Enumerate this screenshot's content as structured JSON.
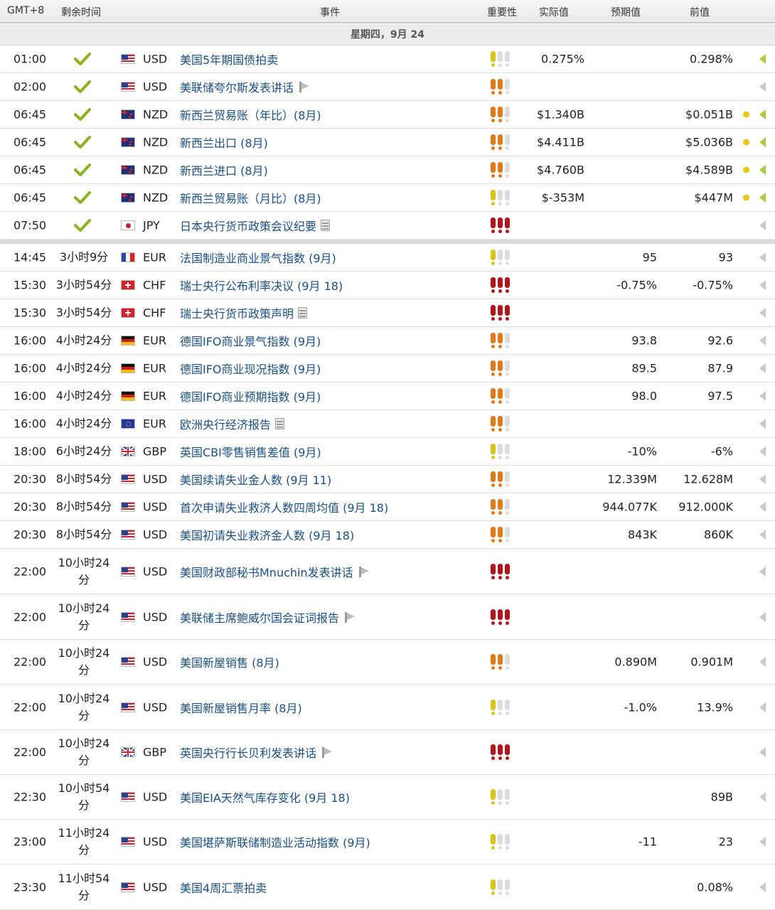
{
  "header": {
    "timezone": "GMT+8",
    "remaining": "剩余时间",
    "event": "事件",
    "importance": "重要性",
    "actual": "实际值",
    "forecast": "预期值",
    "previous": "前值"
  },
  "day_label": "星期四，9月 24",
  "colors": {
    "importance_low": "#d9c417",
    "importance_medium": "#e07a18",
    "importance_high": "#b3131a",
    "released_check": "#8cb21f",
    "event_link": "#1a4f86"
  },
  "rows": [
    {
      "time": "01:00",
      "released": true,
      "remaining": "",
      "flag": "us",
      "currency": "USD",
      "event": "美国5年期国债拍卖",
      "event_icon": "",
      "importance": 1,
      "actual": "0.275%",
      "forecast": "",
      "previous": "0.298%",
      "dot": false,
      "arrow": "green"
    },
    {
      "time": "02:00",
      "released": true,
      "remaining": "",
      "flag": "us",
      "currency": "USD",
      "event": "美联储夸尔斯发表讲话",
      "event_icon": "speech-icon",
      "importance": 2,
      "actual": "",
      "forecast": "",
      "previous": "",
      "dot": false,
      "arrow": "gray"
    },
    {
      "time": "06:45",
      "released": true,
      "remaining": "",
      "flag": "nz",
      "currency": "NZD",
      "event": "新西兰贸易账（年比）(8月)",
      "event_icon": "",
      "importance": 2,
      "actual": "$1.340B",
      "forecast": "",
      "previous": "$0.051B",
      "dot": true,
      "arrow": "green"
    },
    {
      "time": "06:45",
      "released": true,
      "remaining": "",
      "flag": "nz",
      "currency": "NZD",
      "event": "新西兰出口 (8月)",
      "event_icon": "",
      "importance": 2,
      "actual": "$4.411B",
      "forecast": "",
      "previous": "$5.036B",
      "dot": true,
      "arrow": "green"
    },
    {
      "time": "06:45",
      "released": true,
      "remaining": "",
      "flag": "nz",
      "currency": "NZD",
      "event": "新西兰进口 (8月)",
      "event_icon": "",
      "importance": 2,
      "actual": "$4.760B",
      "forecast": "",
      "previous": "$4.589B",
      "dot": true,
      "arrow": "green"
    },
    {
      "time": "06:45",
      "released": true,
      "remaining": "",
      "flag": "nz",
      "currency": "NZD",
      "event": "新西兰贸易账（月比）(8月)",
      "event_icon": "",
      "importance": 1,
      "actual": "$-353M",
      "forecast": "",
      "previous": "$447M",
      "dot": true,
      "arrow": "green"
    },
    {
      "time": "07:50",
      "released": true,
      "remaining": "",
      "flag": "jp",
      "currency": "JPY",
      "event": "日本央行货币政策会议纪要",
      "event_icon": "document-icon",
      "importance": 3,
      "actual": "",
      "forecast": "",
      "previous": "",
      "dot": false,
      "arrow": "gray"
    },
    {
      "time": "14:45",
      "released": false,
      "remaining": "3小时9分",
      "flag": "fr",
      "currency": "EUR",
      "event": "法国制造业商业景气指数 (9月)",
      "event_icon": "",
      "importance": 1,
      "actual": "",
      "forecast": "95",
      "previous": "93",
      "dot": false,
      "arrow": "gray"
    },
    {
      "time": "15:30",
      "released": false,
      "remaining": "3小时54分",
      "flag": "ch",
      "currency": "CHF",
      "event": "瑞士央行公布利率决议 (9月 18)",
      "event_icon": "",
      "importance": 3,
      "actual": "",
      "forecast": "-0.75%",
      "previous": "-0.75%",
      "dot": false,
      "arrow": "gray"
    },
    {
      "time": "15:30",
      "released": false,
      "remaining": "3小时54分",
      "flag": "ch",
      "currency": "CHF",
      "event": "瑞士央行货币政策声明",
      "event_icon": "document-icon",
      "importance": 3,
      "actual": "",
      "forecast": "",
      "previous": "",
      "dot": false,
      "arrow": "gray"
    },
    {
      "time": "16:00",
      "released": false,
      "remaining": "4小时24分",
      "flag": "de",
      "currency": "EUR",
      "event": "德国IFO商业景气指数 (9月)",
      "event_icon": "",
      "importance": 2,
      "actual": "",
      "forecast": "93.8",
      "previous": "92.6",
      "dot": false,
      "arrow": "gray"
    },
    {
      "time": "16:00",
      "released": false,
      "remaining": "4小时24分",
      "flag": "de",
      "currency": "EUR",
      "event": "德国IFO商业现况指数 (9月)",
      "event_icon": "",
      "importance": 2,
      "actual": "",
      "forecast": "89.5",
      "previous": "87.9",
      "dot": false,
      "arrow": "gray"
    },
    {
      "time": "16:00",
      "released": false,
      "remaining": "4小时24分",
      "flag": "de",
      "currency": "EUR",
      "event": "德国IFO商业预期指数 (9月)",
      "event_icon": "",
      "importance": 2,
      "actual": "",
      "forecast": "98.0",
      "previous": "97.5",
      "dot": false,
      "arrow": "gray"
    },
    {
      "time": "16:00",
      "released": false,
      "remaining": "4小时24分",
      "flag": "eu",
      "currency": "EUR",
      "event": "欧洲央行经济报告",
      "event_icon": "document-icon",
      "importance": 2,
      "actual": "",
      "forecast": "",
      "previous": "",
      "dot": false,
      "arrow": "gray"
    },
    {
      "time": "18:00",
      "released": false,
      "remaining": "6小时24分",
      "flag": "gb",
      "currency": "GBP",
      "event": "英国CBI零售销售差值 (9月)",
      "event_icon": "",
      "importance": 1,
      "actual": "",
      "forecast": "-10%",
      "previous": "-6%",
      "dot": false,
      "arrow": "gray"
    },
    {
      "time": "20:30",
      "released": false,
      "remaining": "8小时54分",
      "flag": "us",
      "currency": "USD",
      "event": "美国续请失业金人数 (9月 11)",
      "event_icon": "",
      "importance": 2,
      "actual": "",
      "forecast": "12.339M",
      "previous": "12.628M",
      "dot": false,
      "arrow": "gray"
    },
    {
      "time": "20:30",
      "released": false,
      "remaining": "8小时54分",
      "flag": "us",
      "currency": "USD",
      "event": "首次申请失业救济人数四周均值 (9月 18)",
      "event_icon": "",
      "importance": 2,
      "actual": "",
      "forecast": "944.077K",
      "previous": "912.000K",
      "dot": false,
      "arrow": "gray"
    },
    {
      "time": "20:30",
      "released": false,
      "remaining": "8小时54分",
      "flag": "us",
      "currency": "USD",
      "event": "美国初请失业救济金人数 (9月 18)",
      "event_icon": "",
      "importance": 2,
      "actual": "",
      "forecast": "843K",
      "previous": "860K",
      "dot": false,
      "arrow": "gray"
    },
    {
      "time": "22:00",
      "released": false,
      "remaining": "10小时24分",
      "flag": "us",
      "currency": "USD",
      "event": "美国财政部秘书Mnuchin发表讲话",
      "event_icon": "speech-icon",
      "importance": 3,
      "actual": "",
      "forecast": "",
      "previous": "",
      "dot": false,
      "arrow": "gray"
    },
    {
      "time": "22:00",
      "released": false,
      "remaining": "10小时24分",
      "flag": "us",
      "currency": "USD",
      "event": "美联储主席鲍威尔国会证词报告",
      "event_icon": "speech-icon",
      "importance": 3,
      "actual": "",
      "forecast": "",
      "previous": "",
      "dot": false,
      "arrow": "gray"
    },
    {
      "time": "22:00",
      "released": false,
      "remaining": "10小时24分",
      "flag": "us",
      "currency": "USD",
      "event": "美国新屋销售 (8月)",
      "event_icon": "",
      "importance": 2,
      "actual": "",
      "forecast": "0.890M",
      "previous": "0.901M",
      "dot": false,
      "arrow": "gray"
    },
    {
      "time": "22:00",
      "released": false,
      "remaining": "10小时24分",
      "flag": "us",
      "currency": "USD",
      "event": "美国新屋销售月率 (8月)",
      "event_icon": "",
      "importance": 1,
      "actual": "",
      "forecast": "-1.0%",
      "previous": "13.9%",
      "dot": false,
      "arrow": "gray"
    },
    {
      "time": "22:00",
      "released": false,
      "remaining": "10小时24分",
      "flag": "gb",
      "currency": "GBP",
      "event": "英国央行行长贝利发表讲话",
      "event_icon": "speech-icon",
      "importance": 3,
      "actual": "",
      "forecast": "",
      "previous": "",
      "dot": false,
      "arrow": "gray"
    },
    {
      "time": "22:30",
      "released": false,
      "remaining": "10小时54分",
      "flag": "us",
      "currency": "USD",
      "event": "美国EIA天然气库存变化 (9月 18)",
      "event_icon": "",
      "importance": 1,
      "actual": "",
      "forecast": "",
      "previous": "89B",
      "dot": false,
      "arrow": "gray"
    },
    {
      "time": "23:00",
      "released": false,
      "remaining": "11小时24分",
      "flag": "us",
      "currency": "USD",
      "event": "美国堪萨斯联储制造业活动指数 (9月)",
      "event_icon": "",
      "importance": 1,
      "actual": "",
      "forecast": "-11",
      "previous": "23",
      "dot": false,
      "arrow": "gray"
    },
    {
      "time": "23:30",
      "released": false,
      "remaining": "11小时54分",
      "flag": "us",
      "currency": "USD",
      "event": "美国4周汇票拍卖",
      "event_icon": "",
      "importance": 1,
      "actual": "",
      "forecast": "",
      "previous": "0.08%",
      "dot": false,
      "arrow": "gray"
    }
  ]
}
